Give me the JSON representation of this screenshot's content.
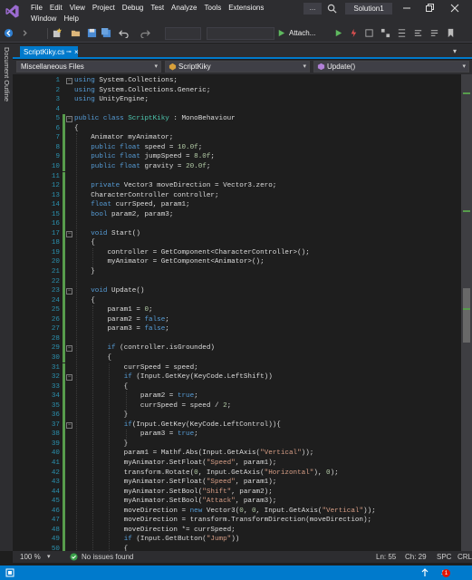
{
  "menu": {
    "row1": [
      "File",
      "Edit",
      "View",
      "Project",
      "Debug",
      "Test",
      "Analyze",
      "Tools",
      "Extensions"
    ],
    "row2": [
      "Window",
      "Help"
    ],
    "search_label": "...",
    "solution_name": "Solution1"
  },
  "toolbar": {
    "attach_label": "Attach..."
  },
  "side_panel": {
    "label": "Document Outline"
  },
  "doc_tab": {
    "label": "ScriptKiky.cs",
    "pin": "⊸",
    "close": "×"
  },
  "navbar": {
    "project": "Miscellaneous Files",
    "class": "ScriptKiky",
    "member": "Update()"
  },
  "editor": {
    "lines": [
      [
        [
          "kw",
          "using"
        ],
        [
          "pl",
          " System.Collections;"
        ]
      ],
      [
        [
          "kw",
          "using"
        ],
        [
          "pl",
          " System.Collections.Generic;"
        ]
      ],
      [
        [
          "kw",
          "using"
        ],
        [
          "pl",
          " UnityEngine;"
        ]
      ],
      [],
      [
        [
          "kw",
          "public class "
        ],
        [
          "ty",
          "ScriptKiky"
        ],
        [
          "pl",
          " : MonoBehaviour"
        ]
      ],
      [
        [
          "pl",
          "{"
        ]
      ],
      [
        [
          "pl",
          "    Animator myAnimator;"
        ]
      ],
      [
        [
          "pl",
          "    "
        ],
        [
          "kw",
          "public float"
        ],
        [
          "pl",
          " speed = "
        ],
        [
          "nu",
          "10.0f"
        ],
        [
          "pl",
          ";"
        ]
      ],
      [
        [
          "pl",
          "    "
        ],
        [
          "kw",
          "public float"
        ],
        [
          "pl",
          " jumpSpeed = "
        ],
        [
          "nu",
          "8.0f"
        ],
        [
          "pl",
          ";"
        ]
      ],
      [
        [
          "pl",
          "    "
        ],
        [
          "kw",
          "public float"
        ],
        [
          "pl",
          " gravity = "
        ],
        [
          "nu",
          "20.0f"
        ],
        [
          "pl",
          ";"
        ]
      ],
      [],
      [
        [
          "pl",
          "    "
        ],
        [
          "kw",
          "private"
        ],
        [
          "pl",
          " Vector3 moveDirection = Vector3.zero;"
        ]
      ],
      [
        [
          "pl",
          "    CharacterController controller;"
        ]
      ],
      [
        [
          "pl",
          "    "
        ],
        [
          "kw",
          "float"
        ],
        [
          "pl",
          " currSpeed, param1;"
        ]
      ],
      [
        [
          "pl",
          "    "
        ],
        [
          "kw",
          "bool"
        ],
        [
          "pl",
          " param2, param3;"
        ]
      ],
      [],
      [
        [
          "pl",
          "    "
        ],
        [
          "kw",
          "void"
        ],
        [
          "pl",
          " Start()"
        ]
      ],
      [
        [
          "pl",
          "    {"
        ]
      ],
      [
        [
          "pl",
          "        controller = GetComponent<CharacterController>();"
        ]
      ],
      [
        [
          "pl",
          "        myAnimator = GetComponent<Animator>();"
        ]
      ],
      [
        [
          "pl",
          "    }"
        ]
      ],
      [],
      [
        [
          "pl",
          "    "
        ],
        [
          "kw",
          "void"
        ],
        [
          "pl",
          " Update()"
        ]
      ],
      [
        [
          "pl",
          "    {"
        ]
      ],
      [
        [
          "pl",
          "        param1 = "
        ],
        [
          "nu",
          "0"
        ],
        [
          "pl",
          ";"
        ]
      ],
      [
        [
          "pl",
          "        param2 = "
        ],
        [
          "kw",
          "false"
        ],
        [
          "pl",
          ";"
        ]
      ],
      [
        [
          "pl",
          "        param3 = "
        ],
        [
          "kw",
          "false"
        ],
        [
          "pl",
          ";"
        ]
      ],
      [],
      [
        [
          "pl",
          "        "
        ],
        [
          "kw",
          "if"
        ],
        [
          "pl",
          " (controller.isGrounded)"
        ]
      ],
      [
        [
          "pl",
          "        {"
        ]
      ],
      [
        [
          "pl",
          "            currSpeed = speed;"
        ]
      ],
      [
        [
          "pl",
          "            "
        ],
        [
          "kw",
          "if"
        ],
        [
          "pl",
          " (Input.GetKey(KeyCode.LeftShift))"
        ]
      ],
      [
        [
          "pl",
          "            {"
        ]
      ],
      [
        [
          "pl",
          "                param2 = "
        ],
        [
          "kw",
          "true"
        ],
        [
          "pl",
          ";"
        ]
      ],
      [
        [
          "pl",
          "                currSpeed = speed / "
        ],
        [
          "nu",
          "2"
        ],
        [
          "pl",
          ";"
        ]
      ],
      [
        [
          "pl",
          "            }"
        ]
      ],
      [
        [
          "pl",
          "            "
        ],
        [
          "kw",
          "if"
        ],
        [
          "pl",
          "(Input.GetKey(KeyCode.LeftControl)){"
        ]
      ],
      [
        [
          "pl",
          "                param3 = "
        ],
        [
          "kw",
          "true"
        ],
        [
          "pl",
          ";"
        ]
      ],
      [
        [
          "pl",
          "            }"
        ]
      ],
      [
        [
          "pl",
          "            param1 = Mathf.Abs(Input.GetAxis("
        ],
        [
          "st",
          "\"Vertical\""
        ],
        [
          "pl",
          "));"
        ]
      ],
      [
        [
          "pl",
          "            myAnimator.SetFloat("
        ],
        [
          "st",
          "\"Speed\""
        ],
        [
          "pl",
          ", param1);"
        ]
      ],
      [
        [
          "pl",
          "            transform.Rotate("
        ],
        [
          "nu",
          "0"
        ],
        [
          "pl",
          ", Input.GetAxis("
        ],
        [
          "st",
          "\"Horizontal\""
        ],
        [
          "pl",
          "), "
        ],
        [
          "nu",
          "0"
        ],
        [
          "pl",
          ");"
        ]
      ],
      [
        [
          "pl",
          "            myAnimator.SetFloat("
        ],
        [
          "st",
          "\"Speed\""
        ],
        [
          "pl",
          ", param1);"
        ]
      ],
      [
        [
          "pl",
          "            myAnimator.SetBool("
        ],
        [
          "st",
          "\"Shift\""
        ],
        [
          "pl",
          ", param2);"
        ]
      ],
      [
        [
          "pl",
          "            myAnimator.SetBool("
        ],
        [
          "st",
          "\"Attack\""
        ],
        [
          "pl",
          ", param3);"
        ]
      ],
      [
        [
          "pl",
          "            moveDirection = "
        ],
        [
          "kw",
          "new"
        ],
        [
          "pl",
          " Vector3("
        ],
        [
          "nu",
          "0"
        ],
        [
          "pl",
          ", "
        ],
        [
          "nu",
          "0"
        ],
        [
          "pl",
          ", Input.GetAxis("
        ],
        [
          "st",
          "\"Vertical\""
        ],
        [
          "pl",
          "));"
        ]
      ],
      [
        [
          "pl",
          "            moveDirection = transform.TransformDirection(moveDirection);"
        ]
      ],
      [
        [
          "pl",
          "            moveDirection *= currSpeed;"
        ]
      ],
      [
        [
          "pl",
          "            "
        ],
        [
          "kw",
          "if"
        ],
        [
          "pl",
          " (Input.GetButton("
        ],
        [
          "st",
          "\"Jump\""
        ],
        [
          "pl",
          "))"
        ]
      ],
      [
        [
          "pl",
          "            {"
        ]
      ]
    ],
    "changed_lines": [
      5,
      6,
      7,
      8,
      9,
      10,
      11,
      12,
      13,
      14,
      15,
      16,
      17,
      18,
      19,
      20,
      21,
      22,
      23,
      24,
      25,
      26,
      27,
      28,
      29,
      30,
      31,
      32,
      33,
      34,
      35,
      36,
      37,
      38,
      39,
      40,
      41,
      42,
      43,
      44,
      45,
      46,
      47,
      48,
      49,
      50
    ],
    "change_color": "#579c4c"
  },
  "edstatus": {
    "zoom": "100 %",
    "issues": "No issues found",
    "ln": "Ln: 55",
    "ch": "Ch: 29",
    "spc": "SPC",
    "crlf": "CRLF"
  },
  "statusbar": {
    "notif_count": "1"
  },
  "colors": {
    "accent": "#007acc",
    "keyword": "#569cd6",
    "type": "#4ec9b0",
    "string": "#d69d85",
    "number": "#b5cea8",
    "linenum": "#2b91af"
  }
}
